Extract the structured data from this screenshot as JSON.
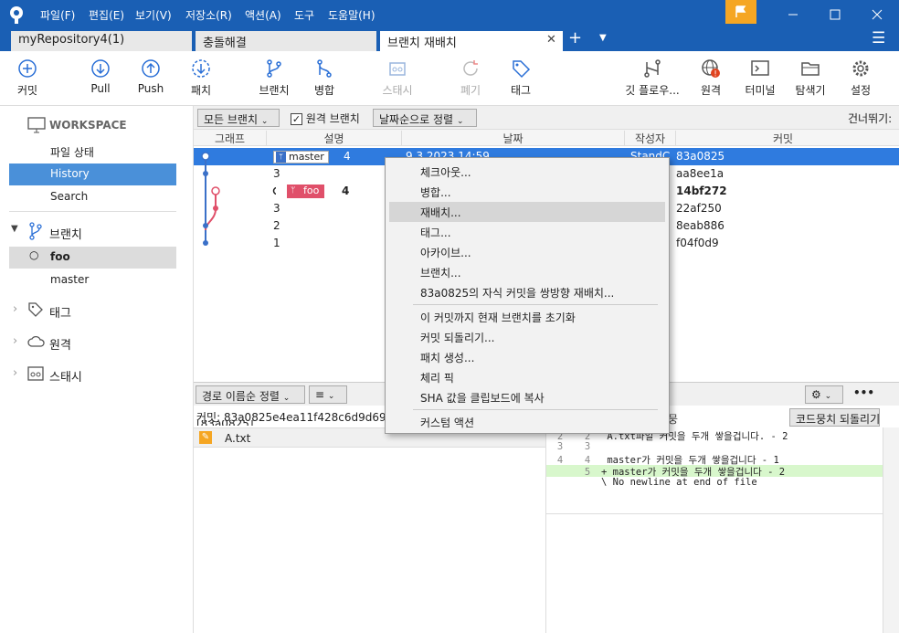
{
  "menu": [
    "파일(F)",
    "편집(E)",
    "보기(V)",
    "저장소(R)",
    "액션(A)",
    "도구",
    "도움말(H)"
  ],
  "tabs": [
    "myRepository4(1)",
    "충돌해결",
    "브랜치 재배치"
  ],
  "toolbar": {
    "commit": "커밋",
    "pull": "Pull",
    "push": "Push",
    "fetch": "패치",
    "branch": "브랜치",
    "merge": "병합",
    "stash": "스태시",
    "discard": "폐기",
    "tag": "태그",
    "gitflow": "깃 플로우...",
    "remote": "원격",
    "terminal": "터미널",
    "explorer": "탐색기",
    "settings": "설정"
  },
  "sidebar": {
    "workspace": "WORKSPACE",
    "file_status": "파일 상태",
    "history": "History",
    "search": "Search",
    "branches": "브랜치",
    "branch_foo": "foo",
    "branch_master": "master",
    "tags": "태그",
    "remotes": "원격",
    "stashes": "스태시"
  },
  "filter": {
    "all_branches": "모든 브랜치",
    "remote_branches": "원격 브랜치",
    "sort_date": "날짜순으로 정렬",
    "skip": "건너뛰기:"
  },
  "columns": {
    "graph": "그래프",
    "desc": "설명",
    "date": "날짜",
    "author": "작성자",
    "commit": "커밋"
  },
  "rows": [
    {
      "badge": "master",
      "desc": "4",
      "date": "9.3.2023 14:59",
      "author": "StandC",
      "hash": "83a0825"
    },
    {
      "badge": "",
      "desc": "3",
      "date": "",
      "author": "",
      "hash": "aa8ee1a"
    },
    {
      "badge": "foo",
      "desc": "4",
      "date": "",
      "author": "",
      "hash": "14bf272"
    },
    {
      "badge": "",
      "desc": "3",
      "date": "",
      "author": "",
      "hash": "22af250"
    },
    {
      "badge": "",
      "desc": "2",
      "date": "",
      "author": "",
      "hash": "8eab886"
    },
    {
      "badge": "",
      "desc": "1",
      "date": "",
      "author": "",
      "hash": "f04f0d9"
    }
  ],
  "context_menu": [
    "체크아웃...",
    "병합...",
    "재배치...",
    "태그...",
    "아카이브...",
    "브랜치...",
    "83a0825의 자식 커밋을 쌍방향 재배치...",
    "이 커밋까지 현재 브랜치를 초기화",
    "커밋 되돌리기...",
    "패치 생성...",
    "체리 픽",
    "SHA 값을 클립보드에 복사",
    "커스텀 액션"
  ],
  "lower": {
    "sort_path": "경로 이름순 정렬",
    "list_icon": "≡",
    "more": "•••",
    "revert_hunk": "코드뭉치 되돌리기",
    "hunk_label": "뭉",
    "commit_label": "커밋: 83a0825e4ea11f428c6d9d69ff2",
    "commit_ref": "[83a0825]",
    "file": "A.txt"
  },
  "diff": [
    {
      "o": "2",
      "n": "2",
      "t": "  A.txt파일 커밋을 두개 쌓을겁니다. - 2",
      "add": false
    },
    {
      "o": "3",
      "n": "3",
      "t": "",
      "add": false
    },
    {
      "o": "4",
      "n": "4",
      "t": "  master가 커밋을 두개 쌓을겁니다 - 1",
      "add": false
    },
    {
      "o": "",
      "n": "5",
      "t": "+ master가 커밋을 두개 쌓을겁니다 - 2",
      "add": true
    },
    {
      "o": "",
      "n": "",
      "t": "\\ No newline at end of file",
      "add": false
    }
  ],
  "colors": {
    "accent": "#1a5fb4",
    "selection": "#2f7bdf",
    "foo_badge": "#e0506a",
    "flag": "#f5a623"
  }
}
